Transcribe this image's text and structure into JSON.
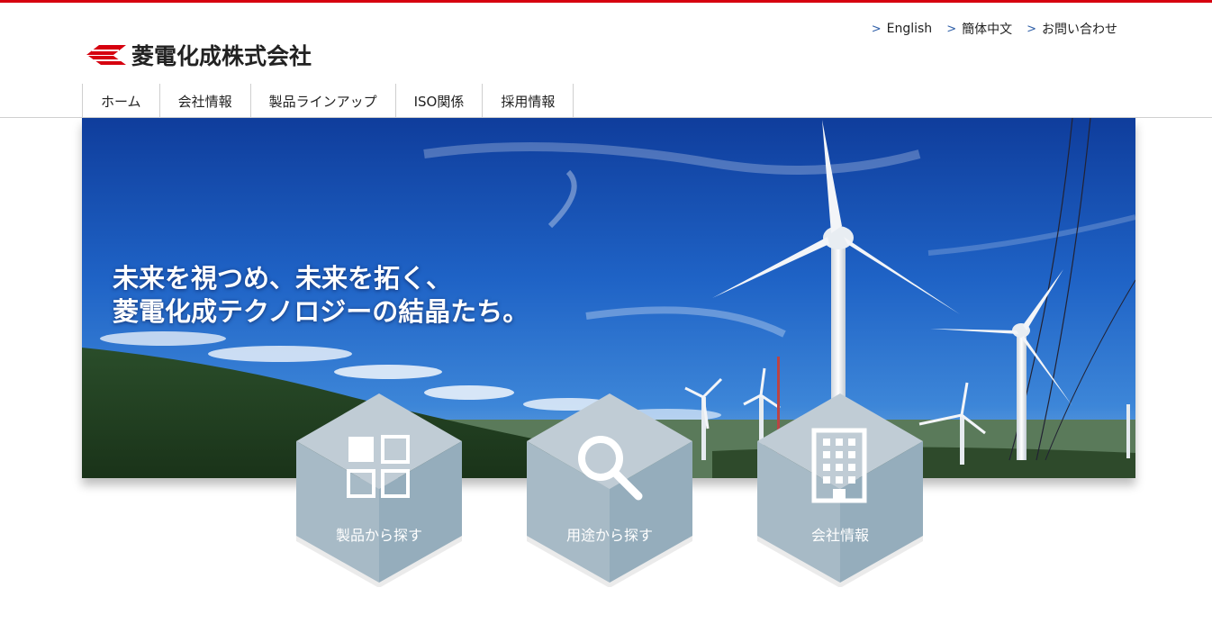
{
  "brand": {
    "name": "菱電化成株式会社",
    "color": "#d6000f"
  },
  "lang_links": [
    {
      "label": "English"
    },
    {
      "label": "簡体中文"
    },
    {
      "label": "お問い合わせ"
    }
  ],
  "nav": [
    {
      "label": "ホーム"
    },
    {
      "label": "会社情報"
    },
    {
      "label": "製品ラインアップ"
    },
    {
      "label": "ISO関係"
    },
    {
      "label": "採用情報"
    }
  ],
  "hero": {
    "line1": "未来を視つめ、未来を拓く、",
    "line2": "菱電化成テクノロジーの結晶たち。"
  },
  "hex_buttons": [
    {
      "label": "製品から探す",
      "icon": "grid-icon"
    },
    {
      "label": "用途から探す",
      "icon": "search-icon"
    },
    {
      "label": "会社情報",
      "icon": "building-icon"
    }
  ]
}
